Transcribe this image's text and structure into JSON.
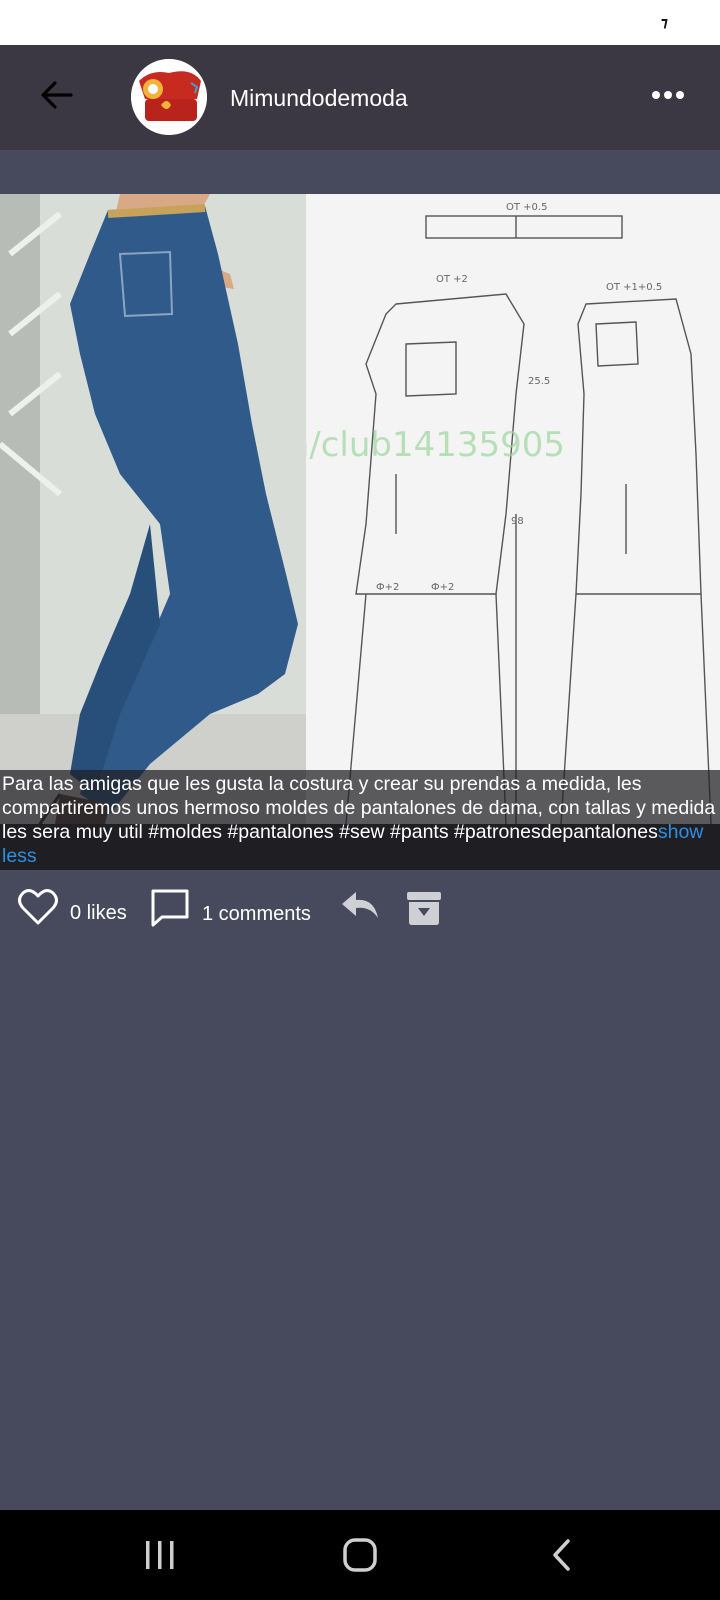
{
  "status_bar": {
    "glyph": "⁊"
  },
  "header": {
    "username": "Mimundodemoda",
    "back_icon": "arrow-left-icon",
    "more_icon": "more-horizontal-icon"
  },
  "post": {
    "image_left": "woman in blue jeans",
    "image_right": "trouser sewing pattern",
    "caption": "Para las amigas que les gusta la costura y crear su prendas a medida, les compartiremos unos hermoso moldes de pantalones de dama, con tallas y medida les sera muy util  #moldes #pantalones #sew #pants #patronesdepantalones",
    "show_less": "show less"
  },
  "actions": {
    "likes_label": "0 likes",
    "comments_label": "1 comments"
  },
  "colors": {
    "background": "#474a5c",
    "header": "#3b3844",
    "link": "#2f8fe0"
  }
}
